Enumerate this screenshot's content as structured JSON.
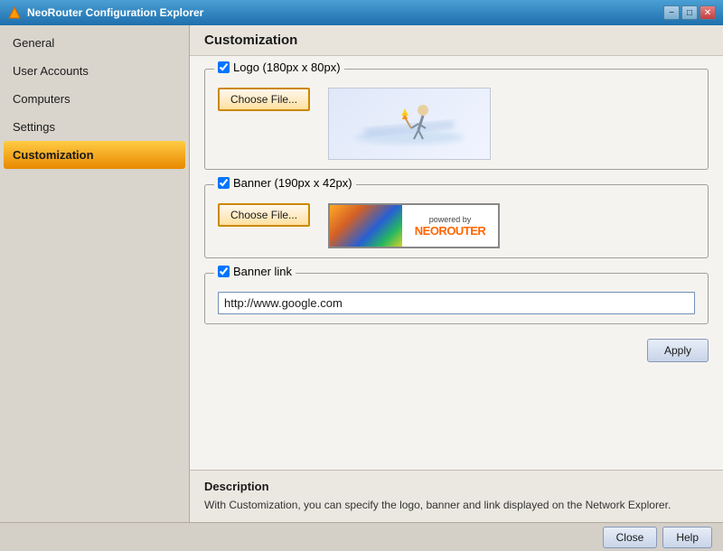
{
  "window": {
    "title": "NeoRouter Configuration Explorer",
    "controls": {
      "minimize": "−",
      "maximize": "□",
      "close": "✕"
    }
  },
  "sidebar": {
    "items": [
      {
        "id": "general",
        "label": "General",
        "active": false
      },
      {
        "id": "user-accounts",
        "label": "User Accounts",
        "active": false
      },
      {
        "id": "computers",
        "label": "Computers",
        "active": false
      },
      {
        "id": "settings",
        "label": "Settings",
        "active": false
      },
      {
        "id": "customization",
        "label": "Customization",
        "active": true
      }
    ]
  },
  "content": {
    "title": "Customization",
    "logo_section": {
      "label": "Logo  (180px x 80px)",
      "checked": true,
      "button": "Choose File..."
    },
    "banner_section": {
      "label": "Banner  (190px x 42px)",
      "checked": true,
      "button": "Choose File...",
      "powered_by": "powered by",
      "brand": "NEOROUTER"
    },
    "banner_link_section": {
      "label": "Banner link",
      "checked": true,
      "value": "http://www.google.com"
    },
    "apply_button": "Apply"
  },
  "description": {
    "title": "Description",
    "text": "With Customization, you can specify the logo, banner and link displayed on the Network Explorer."
  },
  "bottom": {
    "close_label": "Close",
    "help_label": "Help"
  }
}
